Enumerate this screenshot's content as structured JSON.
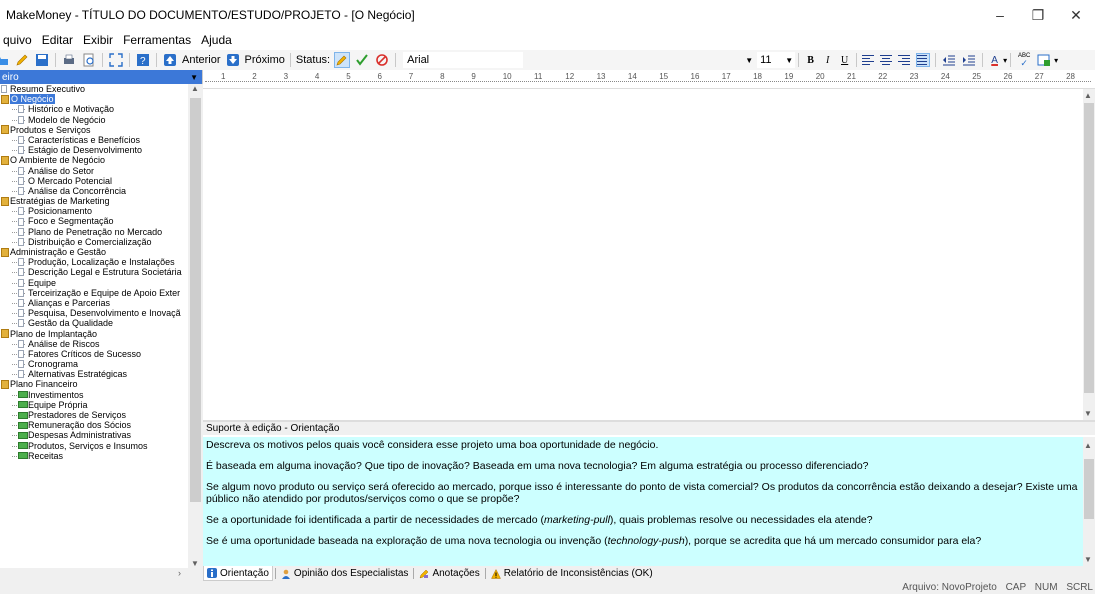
{
  "window": {
    "title": "MakeMoney - TÍTULO DO DOCUMENTO/ESTUDO/PROJETO - [O Negócio]",
    "minimize": "–",
    "maximize": "❐",
    "close": "✕"
  },
  "menu": [
    "quivo",
    "Editar",
    "Exibir",
    "Ferramentas",
    "Ajuda"
  ],
  "toolbar": {
    "prev_label": "Anterior",
    "next_label": "Próximo",
    "status_label": "Status:",
    "font_name": "Arial",
    "font_size": "11",
    "bold": "B",
    "italic": "I",
    "underline": "U",
    "text_color": "A",
    "spell": "ABC"
  },
  "sidebar": {
    "header": "eiro",
    "items": [
      {
        "label": "Resumo Executivo",
        "level": 0,
        "icon": "doc-icon"
      },
      {
        "label": "O Negócio",
        "level": 0,
        "icon": "book-icon",
        "selected": true
      },
      {
        "label": "Histórico e Motivação",
        "level": 1,
        "icon": "doc-icon"
      },
      {
        "label": "Modelo de Negócio",
        "level": 1,
        "icon": "doc-icon"
      },
      {
        "label": "Produtos e Serviços",
        "level": 0,
        "icon": "book-icon"
      },
      {
        "label": "Características e Benefícios",
        "level": 1,
        "icon": "doc-icon"
      },
      {
        "label": "Estágio de Desenvolvimento",
        "level": 1,
        "icon": "doc-icon"
      },
      {
        "label": "O Ambiente de Negócio",
        "level": 0,
        "icon": "book-icon"
      },
      {
        "label": "Análise do Setor",
        "level": 1,
        "icon": "doc-icon"
      },
      {
        "label": "O Mercado Potencial",
        "level": 1,
        "icon": "doc-icon"
      },
      {
        "label": "Análise da Concorrência",
        "level": 1,
        "icon": "doc-icon"
      },
      {
        "label": "Estratégias de Marketing",
        "level": 0,
        "icon": "book-icon"
      },
      {
        "label": "Posicionamento",
        "level": 1,
        "icon": "doc-icon"
      },
      {
        "label": "Foco e Segmentação",
        "level": 1,
        "icon": "doc-icon"
      },
      {
        "label": "Plano de Penetração no Mercado",
        "level": 1,
        "icon": "doc-icon"
      },
      {
        "label": "Distribuição e Comercialização",
        "level": 1,
        "icon": "doc-icon"
      },
      {
        "label": "Administração e Gestão",
        "level": 0,
        "icon": "book-icon"
      },
      {
        "label": "Produção, Localização e Instalações",
        "level": 1,
        "icon": "doc-icon"
      },
      {
        "label": "Descrição Legal e Estrutura Societária",
        "level": 1,
        "icon": "doc-icon"
      },
      {
        "label": "Equipe",
        "level": 1,
        "icon": "doc-icon"
      },
      {
        "label": "Terceirização e Equipe de Apoio Exter",
        "level": 1,
        "icon": "doc-icon"
      },
      {
        "label": "Alianças e Parcerias",
        "level": 1,
        "icon": "doc-icon"
      },
      {
        "label": "Pesquisa, Desenvolvimento e Inovaçã",
        "level": 1,
        "icon": "doc-icon"
      },
      {
        "label": "Gestão da Qualidade",
        "level": 1,
        "icon": "doc-icon"
      },
      {
        "label": "Plano de Implantação",
        "level": 0,
        "icon": "book-icon"
      },
      {
        "label": "Análise de Riscos",
        "level": 1,
        "icon": "doc-icon"
      },
      {
        "label": "Fatores Críticos de Sucesso",
        "level": 1,
        "icon": "doc-icon"
      },
      {
        "label": "Cronograma",
        "level": 1,
        "icon": "doc-icon"
      },
      {
        "label": "Alternativas Estratégicas",
        "level": 1,
        "icon": "doc-icon"
      },
      {
        "label": "Plano Financeiro",
        "level": 0,
        "icon": "book-icon"
      },
      {
        "label": "Investimentos",
        "level": 1,
        "icon": "money-icon"
      },
      {
        "label": "Equipe Própria",
        "level": 1,
        "icon": "money-icon"
      },
      {
        "label": "Prestadores de Serviços",
        "level": 1,
        "icon": "money-icon"
      },
      {
        "label": "Remuneração dos Sócios",
        "level": 1,
        "icon": "money-icon"
      },
      {
        "label": "Despesas Administrativas",
        "level": 1,
        "icon": "money-icon"
      },
      {
        "label": "Produtos, Serviços e Insumos",
        "level": 1,
        "icon": "money-icon"
      },
      {
        "label": "Receitas",
        "level": 1,
        "icon": "money-icon"
      }
    ]
  },
  "ruler": {
    "ticks": [
      "1",
      "2",
      "3",
      "4",
      "5",
      "6",
      "7",
      "8",
      "9",
      "10",
      "11",
      "12",
      "13",
      "14",
      "15",
      "16",
      "17",
      "18",
      "19",
      "20",
      "21",
      "22",
      "23",
      "24",
      "25",
      "26",
      "27",
      "28"
    ]
  },
  "help": {
    "title": "Suporte à edição - Orientação",
    "p1": "Descreva os motivos pelos quais você considera esse projeto uma boa oportunidade de negócio.",
    "p2": "É baseada em alguma inovação? Que tipo de inovação? Baseada em uma nova tecnologia? Em alguma estratégia ou processo diferenciado?",
    "p3": "Se algum novo produto ou serviço será oferecido ao mercado, porque isso é interessante do ponto de vista comercial? Os produtos da concorrência estão deixando a desejar? Existe uma público não atendido por produtos/serviços como o que se propõe?",
    "p4_a": "Se a oportunidade foi identificada a partir de necessidades de mercado (",
    "p4_em": "marketing-pull",
    "p4_b": "), quais problemas resolve ou necessidades ela atende?",
    "p5_a": "Se é uma oportunidade baseada na exploração de uma nova tecnologia ou invenção (",
    "p5_em": "technology-push",
    "p5_b": "), porque se acredita que há um mercado consumidor para ela?"
  },
  "tabs": [
    {
      "label": "Orientação",
      "icon": "info-icon"
    },
    {
      "label": "Opinião dos Especialistas",
      "icon": "people-icon"
    },
    {
      "label": "Anotações",
      "icon": "pencil-icon"
    },
    {
      "label": "Relatório de Inconsistências (OK)",
      "icon": "warning-icon"
    }
  ],
  "status": {
    "file": "Arquivo: NovoProjeto",
    "caps": "CAP",
    "num": "NUM",
    "scrl": "SCRL"
  }
}
